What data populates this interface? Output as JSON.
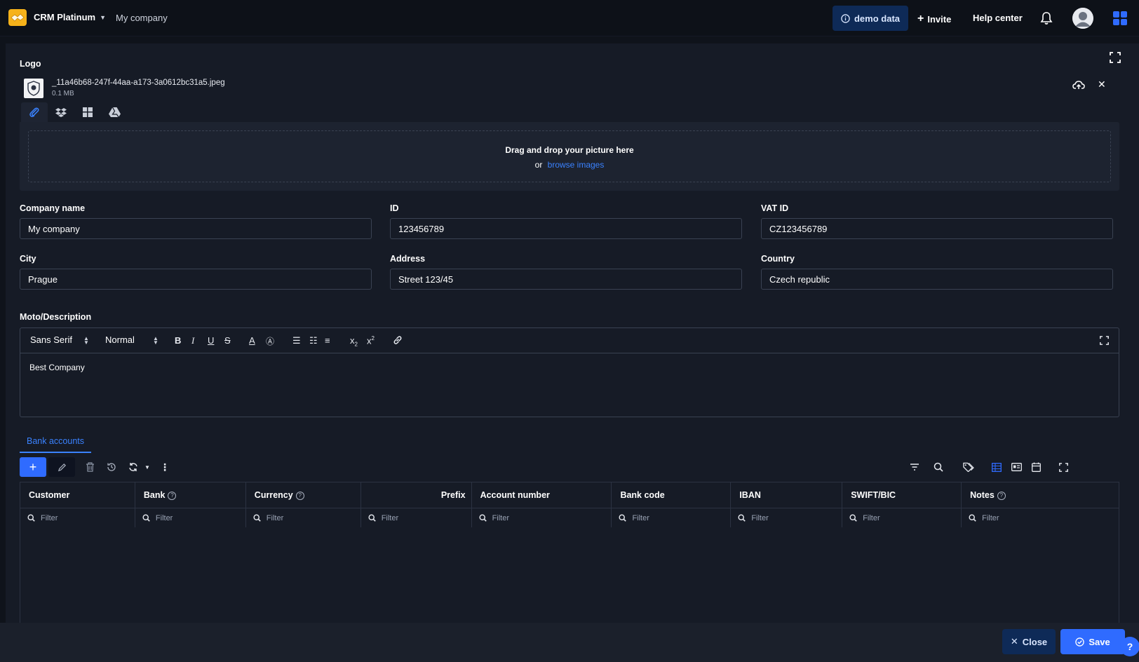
{
  "topbar": {
    "app_name": "CRM Platinum",
    "company": "My company",
    "demo_label": "demo data",
    "invite_label": "Invite",
    "help_label": "Help center"
  },
  "logo": {
    "label": "Logo",
    "file_name": "_11a46b68-247f-44aa-a173-3a0612bc31a5.jpeg",
    "file_size": "0.1 MB",
    "drop_title": "Drag and drop your picture here",
    "drop_or": "or",
    "browse_label": "browse images"
  },
  "form": {
    "company_name": {
      "label": "Company name",
      "value": "My company"
    },
    "id": {
      "label": "ID",
      "value": "123456789"
    },
    "vat_id": {
      "label": "VAT ID",
      "value": "CZ123456789"
    },
    "city": {
      "label": "City",
      "value": "Prague"
    },
    "address": {
      "label": "Address",
      "value": "Street 123/45"
    },
    "country": {
      "label": "Country",
      "value": "Czech republic"
    }
  },
  "editor": {
    "label": "Moto/Description",
    "font": "Sans Serif",
    "size": "Normal",
    "content": "Best Company"
  },
  "bank": {
    "tab_label": "Bank accounts",
    "columns": [
      {
        "label": "Customer",
        "help": false
      },
      {
        "label": "Bank",
        "help": true
      },
      {
        "label": "Currency",
        "help": true
      },
      {
        "label": "Prefix",
        "help": false
      },
      {
        "label": "Account number",
        "help": false
      },
      {
        "label": "Bank code",
        "help": false
      },
      {
        "label": "IBAN",
        "help": false
      },
      {
        "label": "SWIFT/BIC",
        "help": false
      },
      {
        "label": "Notes",
        "help": true
      }
    ],
    "filter_placeholder": "Filter"
  },
  "footer": {
    "close_label": "Close",
    "save_label": "Save",
    "help_label": "?"
  },
  "colors": {
    "accent": "#2f6bff",
    "background": "#0f131b",
    "panel": "#161b26",
    "link": "#3a82ff"
  }
}
